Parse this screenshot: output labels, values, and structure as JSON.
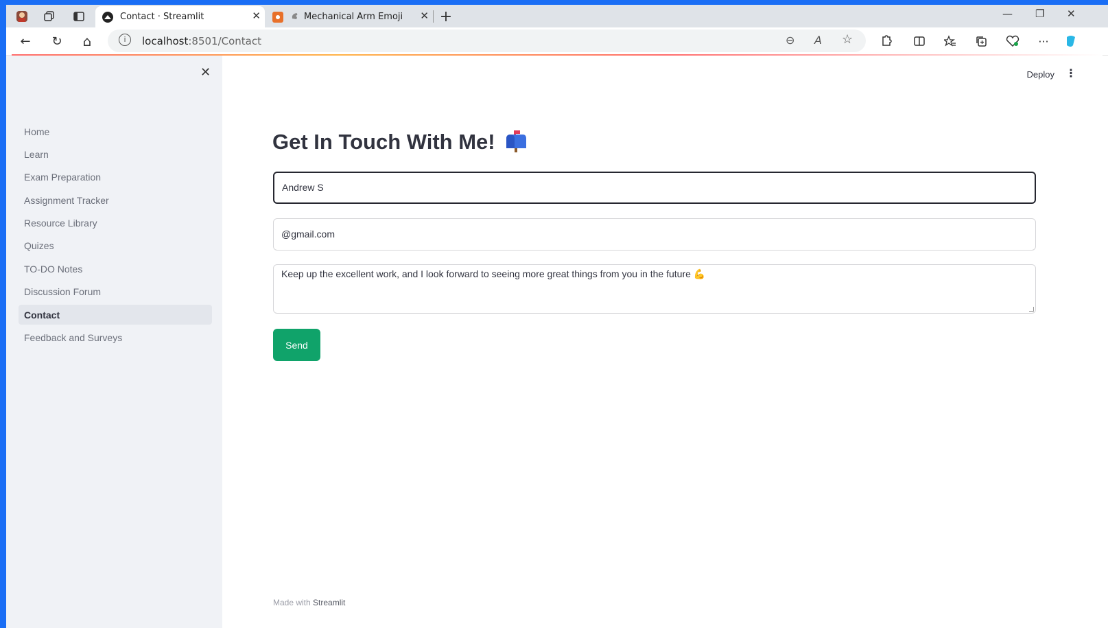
{
  "browser": {
    "tabs": [
      {
        "title": "Contact · Streamlit",
        "active": true
      },
      {
        "title": "Mechanical Arm Emoji",
        "active": false
      }
    ],
    "url_host": "localhost",
    "url_path": ":8501/Contact",
    "close_glyph": "✕",
    "new_tab_glyph": "+",
    "minimize_glyph": "—",
    "restore_glyph": "❐",
    "window_close_glyph": "✕",
    "back_glyph": "←",
    "reload_glyph": "↻",
    "home_glyph": "⌂",
    "info_glyph": "i",
    "zoom_glyph": "⊖",
    "read_aloud_glyph": "A",
    "favorite_glyph": "☆",
    "more_glyph": "···"
  },
  "sidebar": {
    "close_glyph": "✕",
    "items": [
      {
        "label": "Home",
        "active": false
      },
      {
        "label": "Learn",
        "active": false
      },
      {
        "label": "Exam Preparation",
        "active": false
      },
      {
        "label": "Assignment Tracker",
        "active": false
      },
      {
        "label": "Resource Library",
        "active": false
      },
      {
        "label": "Quizes",
        "active": false
      },
      {
        "label": "TO-DO Notes",
        "active": false
      },
      {
        "label": "Discussion Forum",
        "active": false
      },
      {
        "label": "Contact",
        "active": true
      },
      {
        "label": "Feedback and Surveys",
        "active": false
      }
    ]
  },
  "header": {
    "deploy_label": "Deploy",
    "menu_glyph": "⋮"
  },
  "main": {
    "title": "Get In Touch With Me!",
    "title_emoji": "mailbox-icon",
    "name_value": "Andrew S",
    "email_value": "@gmail.com",
    "message_value": "Keep up the excellent work, and I look forward to seeing more great things from you in the future 💪",
    "send_label": "Send"
  },
  "footer": {
    "prefix": "Made with ",
    "brand": "Streamlit"
  },
  "colors": {
    "accent_green": "#10a36a",
    "sidebar_bg": "#f0f2f6",
    "desktop_blue": "#1a6ef5"
  }
}
